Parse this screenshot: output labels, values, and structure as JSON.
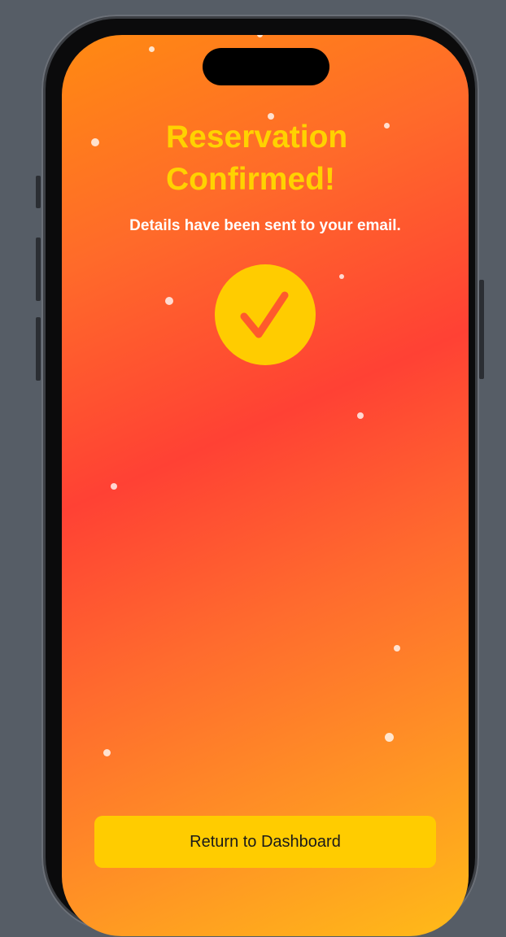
{
  "screen": {
    "title_line1": "Reservation",
    "title_line2": "Confirmed!",
    "subtitle": "Details have been sent to your email.",
    "status_icon": "checkmark-icon",
    "return_button_label": "Return to Dashboard"
  },
  "colors": {
    "accent_yellow": "#ffcc00",
    "gradient_orange": "#ff8a12",
    "gradient_red": "#ff4134",
    "gradient_amber": "#ffbb18",
    "check_stroke": "#ff5a2c"
  }
}
